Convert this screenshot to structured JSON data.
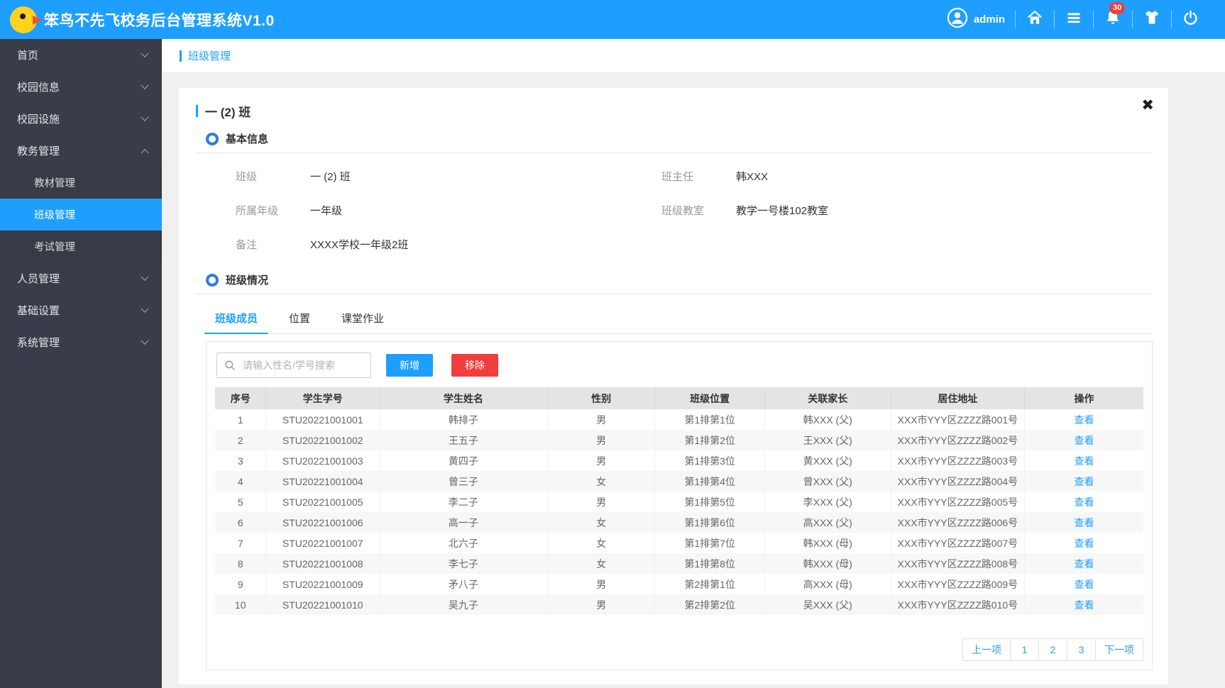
{
  "colors": {
    "primary": "#1E9FFF",
    "sidebar_bg": "#393D49",
    "danger": "#F03E3E",
    "badge": "#F03E3E",
    "table_header_bg": "#E4E4E4"
  },
  "header": {
    "title": "笨鸟不先飞校务后台管理系统V1.0",
    "user_name": "admin",
    "notification_count": "30"
  },
  "sidebar": {
    "items": [
      {
        "label": "首页"
      },
      {
        "label": "校园信息"
      },
      {
        "label": "校园设施"
      },
      {
        "label": "教务管理",
        "children": [
          {
            "label": "教材管理"
          },
          {
            "label": "班级管理"
          },
          {
            "label": "考试管理"
          }
        ]
      },
      {
        "label": "人员管理"
      },
      {
        "label": "基础设置"
      },
      {
        "label": "系统管理"
      }
    ]
  },
  "breadcrumb": {
    "label": "班级管理"
  },
  "card": {
    "title": "一 (2) 班",
    "close_icon": "✖",
    "basic_info": {
      "section_title": "基本信息",
      "left_fields": [
        {
          "label": "班级",
          "value": "一 (2) 班"
        },
        {
          "label": "所属年级",
          "value": "一年级"
        },
        {
          "label": "备注",
          "value": "XXXX学校一年级2班"
        }
      ],
      "right_fields": [
        {
          "label": "班主任",
          "value": "韩XXX"
        },
        {
          "label": "班级教室",
          "value": "教学一号楼102教室"
        }
      ]
    },
    "class_info": {
      "section_title": "班级情况",
      "tabs": [
        {
          "label": "班级成员"
        },
        {
          "label": "位置"
        },
        {
          "label": "课堂作业"
        }
      ]
    },
    "toolbar": {
      "search_placeholder": "请输入性名/学号搜索",
      "add_label": "新增",
      "remove_label": "移除"
    },
    "table": {
      "headers": [
        "序号",
        "学生学号",
        "学生姓名",
        "性别",
        "班级位置",
        "关联家长",
        "居住地址",
        "操作"
      ],
      "action_label": "查看",
      "rows": [
        [
          "1",
          "STU20221001001",
          "韩排子",
          "男",
          "第1排第1位",
          "韩XXX (父)",
          "XXX市YYY区ZZZZ路001号"
        ],
        [
          "2",
          "STU20221001002",
          "王五子",
          "男",
          "第1排第2位",
          "王XXX (父)",
          "XXX市YYY区ZZZZ路002号"
        ],
        [
          "3",
          "STU20221001003",
          "黄四子",
          "男",
          "第1排第3位",
          "黄XXX (父)",
          "XXX市YYY区ZZZZ路003号"
        ],
        [
          "4",
          "STU20221001004",
          "曾三子",
          "女",
          "第1排第4位",
          "曾XXX (父)",
          "XXX市YYY区ZZZZ路004号"
        ],
        [
          "5",
          "STU20221001005",
          "李二子",
          "男",
          "第1排第5位",
          "李XXX (父)",
          "XXX市YYY区ZZZZ路005号"
        ],
        [
          "6",
          "STU20221001006",
          "高一子",
          "女",
          "第1排第6位",
          "高XXX (父)",
          "XXX市YYY区ZZZZ路006号"
        ],
        [
          "7",
          "STU20221001007",
          "北六子",
          "女",
          "第1排第7位",
          "韩XXX (母)",
          "XXX市YYY区ZZZZ路007号"
        ],
        [
          "8",
          "STU20221001008",
          "李七子",
          "女",
          "第1排第8位",
          "韩XXX (母)",
          "XXX市YYY区ZZZZ路008号"
        ],
        [
          "9",
          "STU20221001009",
          "矛八子",
          "男",
          "第2排第1位",
          "高XXX (母)",
          "XXX市YYY区ZZZZ路009号"
        ],
        [
          "10",
          "STU20221001010",
          "吴九子",
          "男",
          "第2排第2位",
          "吴XXX (父)",
          "XXX市YYY区ZZZZ路010号"
        ]
      ]
    },
    "pagination": {
      "prev": "上一项",
      "pages": [
        "1",
        "2",
        "3"
      ],
      "next": "下一项"
    }
  }
}
